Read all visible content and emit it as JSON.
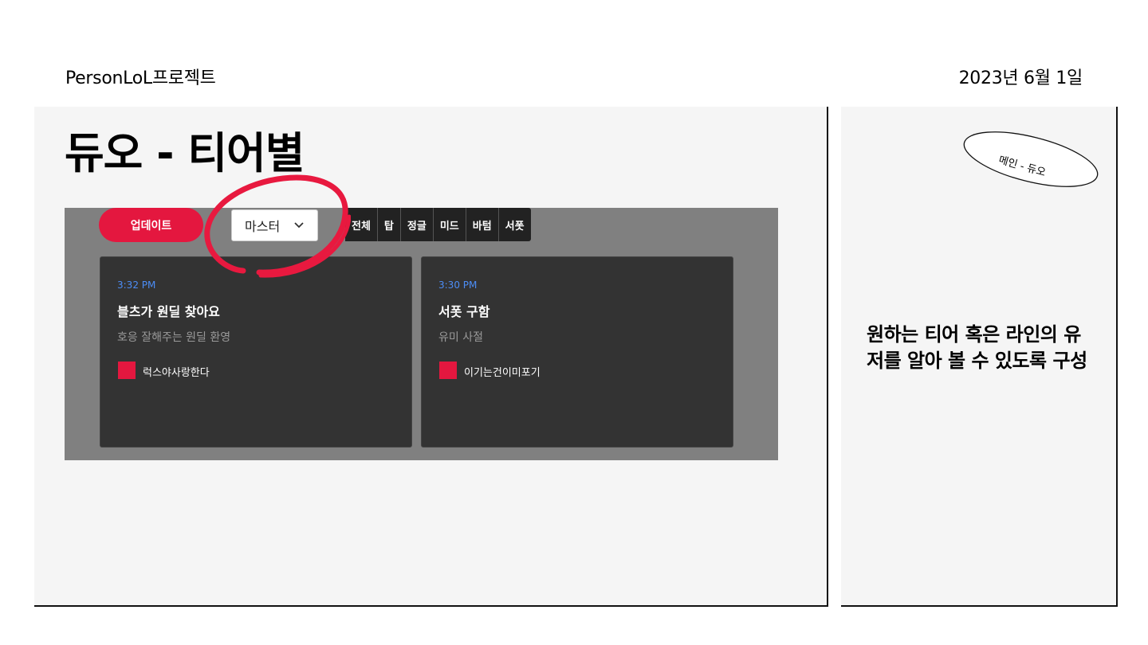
{
  "header": {
    "project": "PersonLoL프로젝트",
    "date": "2023년 6월 1일"
  },
  "main": {
    "title": "듀오 - 티어별"
  },
  "mockup": {
    "update_label": "업데이트",
    "tier_selected": "마스터",
    "lanes": [
      "전체",
      "탑",
      "정글",
      "미드",
      "바텀",
      "서폿"
    ],
    "cards": [
      {
        "time": "3:32 PM",
        "title": "블츠가 원딜 찾아요",
        "desc": "호응 잘해주는 원딜 환영",
        "user": "럭스야사랑한다"
      },
      {
        "time": "3:30 PM",
        "title": "서폿 구함",
        "desc": "유미 사절",
        "user": "이기는건이미포기"
      }
    ]
  },
  "side": {
    "sticker": "메인 - 듀오",
    "description": "원하는 티어 혹은 라인의 유저를 알아 볼 수 있도록 구성"
  },
  "colors": {
    "accent": "#e4173f",
    "time": "#4c8df6",
    "card_bg": "#333333",
    "mock_bg": "#808080",
    "panel_bg": "#f5f5f5"
  }
}
